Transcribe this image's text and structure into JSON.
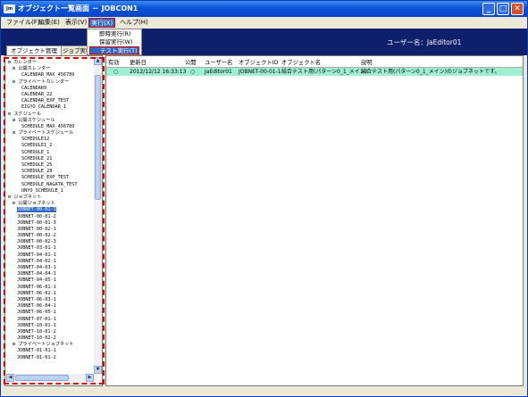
{
  "window": {
    "title": "オブジェクト一覧画面 － JOBCON1",
    "app_icon": "Jm",
    "buttons": [
      "_",
      "□",
      "✕"
    ]
  },
  "menu": [
    "ファイル(F)",
    "編集(E)",
    "表示(V)",
    "実行(X)",
    "ヘルプ(H)"
  ],
  "dropdown": [
    "即時実行(R)",
    "保留実行(W)",
    "テスト実行(T)"
  ],
  "user": {
    "label": "ユーザー名：JaEditor01"
  },
  "tabs": [
    "オブジェクト管理",
    "ジョブ実行"
  ],
  "tree": [
    {
      "t": "⊟ カレンダー",
      "lv": 0
    },
    {
      "t": "⊟ 公開カレンダー",
      "lv": 1
    },
    {
      "t": "CALENDAR_MAX_456789",
      "lv": 3
    },
    {
      "t": "⊟ プライベートカレンダー",
      "lv": 1
    },
    {
      "t": "CALENDAR9",
      "lv": 3
    },
    {
      "t": "CALENDAR_22",
      "lv": 3
    },
    {
      "t": "CALENDAR_EXP_TEST",
      "lv": 3
    },
    {
      "t": "EIGYO_CALENDAR_1",
      "lv": 3
    },
    {
      "t": "⊟ スケジュール",
      "lv": 0
    },
    {
      "t": "⊟ 公開スケジュール",
      "lv": 1
    },
    {
      "t": "SCHEDULE_MAX_456789",
      "lv": 3
    },
    {
      "t": "⊟ プライベートスケジュール",
      "lv": 1
    },
    {
      "t": "SCHEDULE12",
      "lv": 3
    },
    {
      "t": "SCHEDULE1_2",
      "lv": 3
    },
    {
      "t": "SCHEDULE_1",
      "lv": 3
    },
    {
      "t": "SCHEDULE_21",
      "lv": 3
    },
    {
      "t": "SCHEDULE_25",
      "lv": 3
    },
    {
      "t": "SCHEDULE_28",
      "lv": 3
    },
    {
      "t": "SCHEDULE_EXP_TEST",
      "lv": 3
    },
    {
      "t": "SCHEDULE_NAGATA_TEST",
      "lv": 3
    },
    {
      "t": "UNYO_SCHEDULE_1",
      "lv": 3
    },
    {
      "t": "⊟ ジョブネット",
      "lv": 0
    },
    {
      "t": "⊟ 公開ジョブネット",
      "lv": 1
    },
    {
      "t": "JOBNET-00-01-1",
      "lv": 2,
      "sel": true
    },
    {
      "t": "JOBNET-00-01-2",
      "lv": 2
    },
    {
      "t": "JOBNET-00-01-3",
      "lv": 2
    },
    {
      "t": "JOBNET-00-02-1",
      "lv": 2
    },
    {
      "t": "JOBNET-00-02-2",
      "lv": 2
    },
    {
      "t": "JOBNET-00-02-3",
      "lv": 2
    },
    {
      "t": "JOBNET-03-01-1",
      "lv": 2
    },
    {
      "t": "JOBNET-04-01-1",
      "lv": 2
    },
    {
      "t": "JOBNET-04-02-1",
      "lv": 2
    },
    {
      "t": "JOBNET-04-03-1",
      "lv": 2
    },
    {
      "t": "JOBNET-04-04-1",
      "lv": 2
    },
    {
      "t": "JOBNET-04-05-1",
      "lv": 2
    },
    {
      "t": "JOBNET-06-01-1",
      "lv": 2
    },
    {
      "t": "JOBNET-06-02-1",
      "lv": 2
    },
    {
      "t": "JOBNET-06-03-1",
      "lv": 2
    },
    {
      "t": "JOBNET-06-04-1",
      "lv": 2
    },
    {
      "t": "JOBNET-06-05-1",
      "lv": 2
    },
    {
      "t": "JOBNET-07-01-1",
      "lv": 2
    },
    {
      "t": "JOBNET-10-01-1",
      "lv": 2
    },
    {
      "t": "JOBNET-10-01-2",
      "lv": 2
    },
    {
      "t": "JOBNET-10-02-2",
      "lv": 2
    },
    {
      "t": "⊟ プライベートジョブネット",
      "lv": 1
    },
    {
      "t": "JOBNET-01-01-1",
      "lv": 2
    },
    {
      "t": "JOBNET-01-01-2",
      "lv": 2
    }
  ],
  "table": {
    "headers": [
      "有効",
      "更新日",
      "公開",
      "ユーザー名",
      "オブジェクトID",
      "オブジェクト名",
      "説明"
    ],
    "rows": [
      [
        "○",
        "2012/12/12 16:33:13",
        "○",
        "JaEditor01",
        "JOBNET-00-01-1",
        "結合テスト用(パターン0_1_メイン)",
        "結合テスト用(パターン0_1_メイン)のジョブネットです。"
      ]
    ]
  }
}
